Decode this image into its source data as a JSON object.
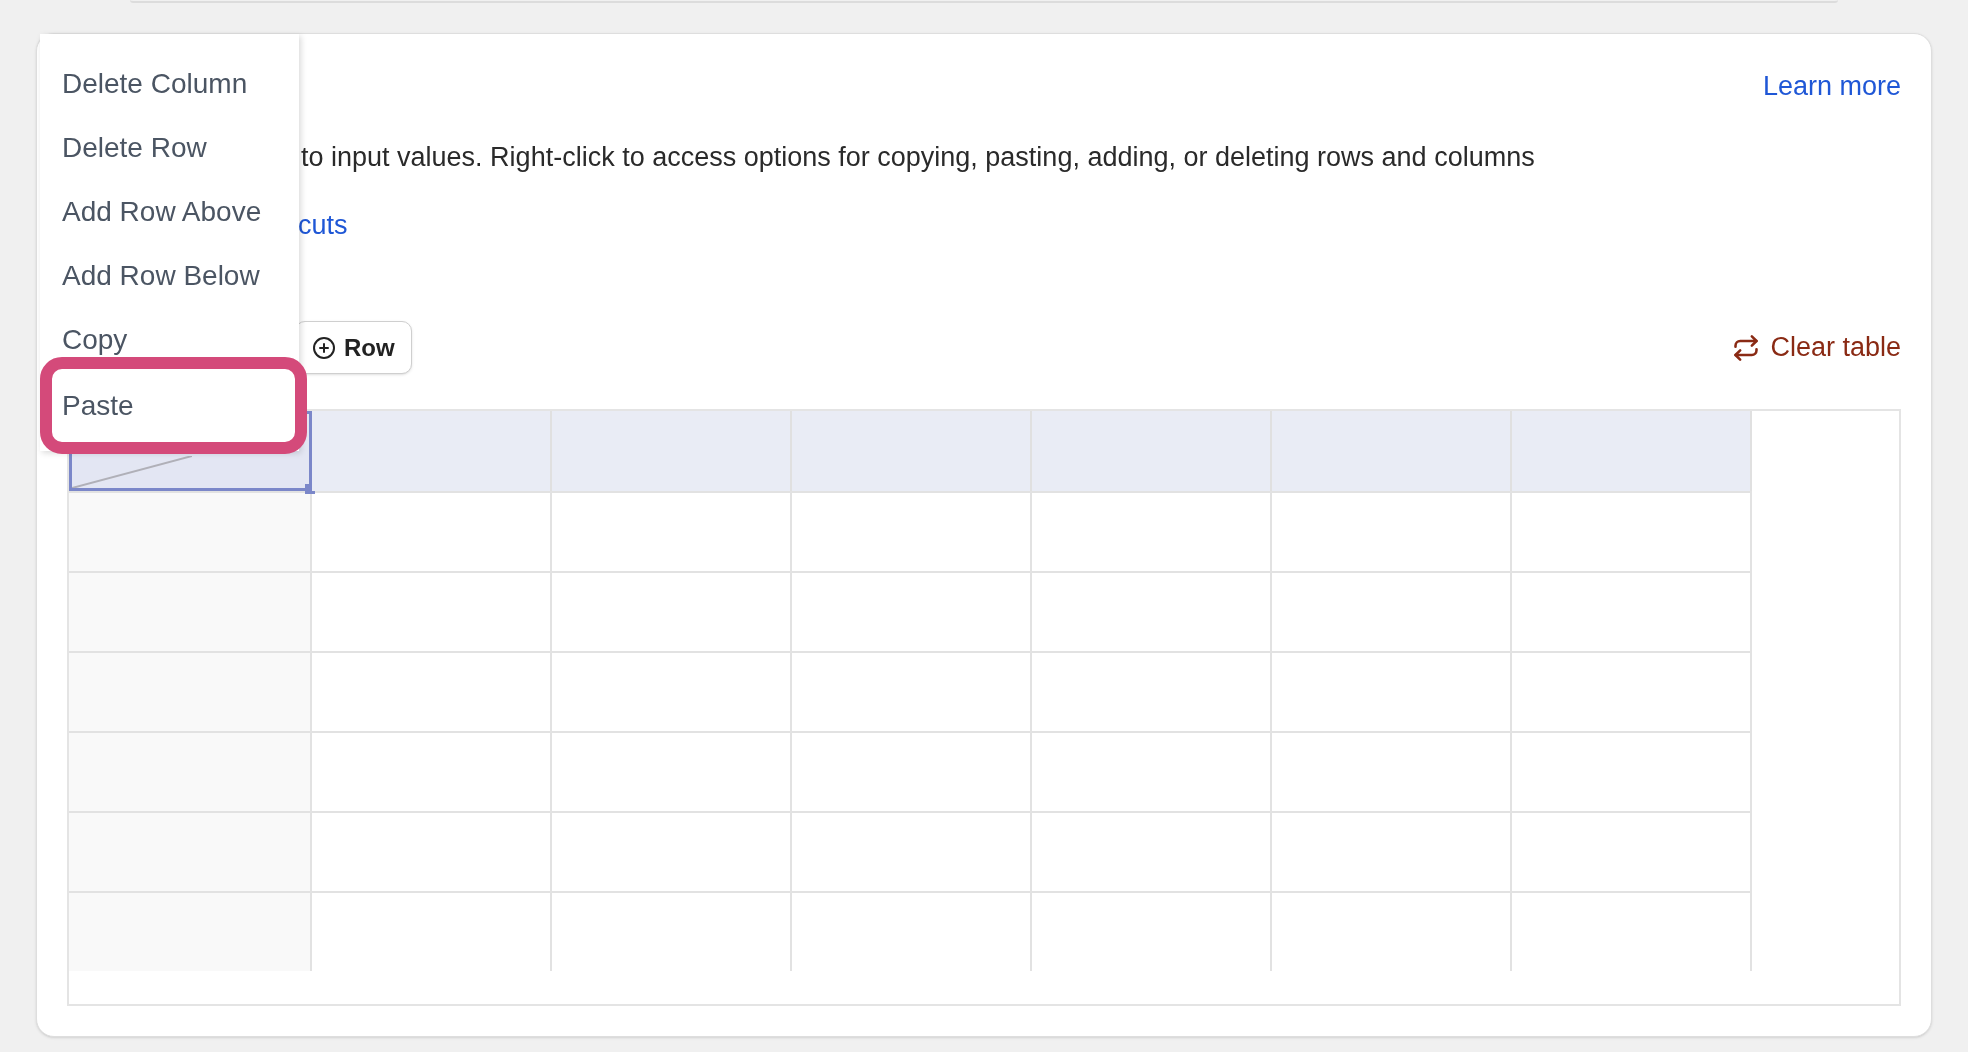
{
  "context_menu": {
    "items": [
      {
        "label": "Delete Column",
        "selected": false
      },
      {
        "label": "Delete Row",
        "selected": false
      },
      {
        "label": "Add Row Above",
        "selected": false
      },
      {
        "label": "Add Row Below",
        "selected": false
      },
      {
        "label": "Copy",
        "selected": false
      },
      {
        "label": "Paste",
        "selected": true
      }
    ]
  },
  "learn_more_link": "Learn more",
  "description": "to input values. Right-click to access options for copying, pasting, adding, or deleting rows and columns",
  "shortcuts_link": "cuts",
  "add_row_button": "Row",
  "clear_table_button": "Clear table",
  "table": {
    "columns": [
      {
        "selected": true
      },
      {
        "selected": false
      },
      {
        "selected": false
      },
      {
        "selected": false
      },
      {
        "selected": false
      },
      {
        "selected": false
      },
      {
        "selected": false
      }
    ],
    "rows": [
      {
        "selected": false
      },
      {
        "selected": false
      },
      {
        "selected": false
      },
      {
        "selected": false
      },
      {
        "selected": false
      },
      {
        "selected": false
      }
    ]
  }
}
